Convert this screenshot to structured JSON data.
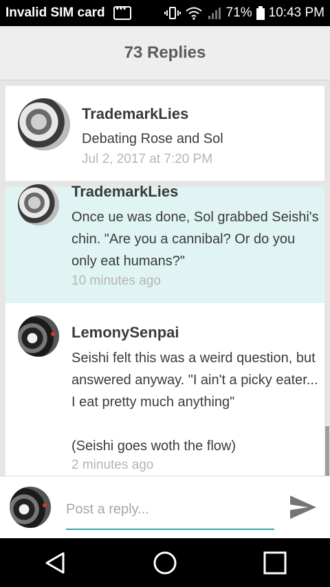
{
  "status_bar": {
    "carrier": "Invalid SIM card",
    "battery": "71%",
    "time": "10:43 PM"
  },
  "header": {
    "title": "73 Replies"
  },
  "topic": {
    "author": "TrademarkLies",
    "subject": "Debating Rose and Sol",
    "timestamp": "Jul 2, 2017 at 7:20 PM"
  },
  "replies": [
    {
      "author": "TrademarkLies",
      "body": "Once ue was done, Sol grabbed Seishi's chin. \"Are you a cannibal? Or do you only eat humans?\"",
      "timestamp": "10 minutes ago"
    },
    {
      "author": "LemonySenpai",
      "body": "Seishi felt this was a weird question, but answered anyway. \"I ain't a picky eater... I eat pretty much anything\"\n\n(Seishi goes woth the flow)",
      "timestamp": "2 minutes ago"
    }
  ],
  "composer": {
    "placeholder": "Post a reply..."
  },
  "colors": {
    "accent": "#2ea8a0",
    "highlight_bg": "#e0f4f4"
  }
}
